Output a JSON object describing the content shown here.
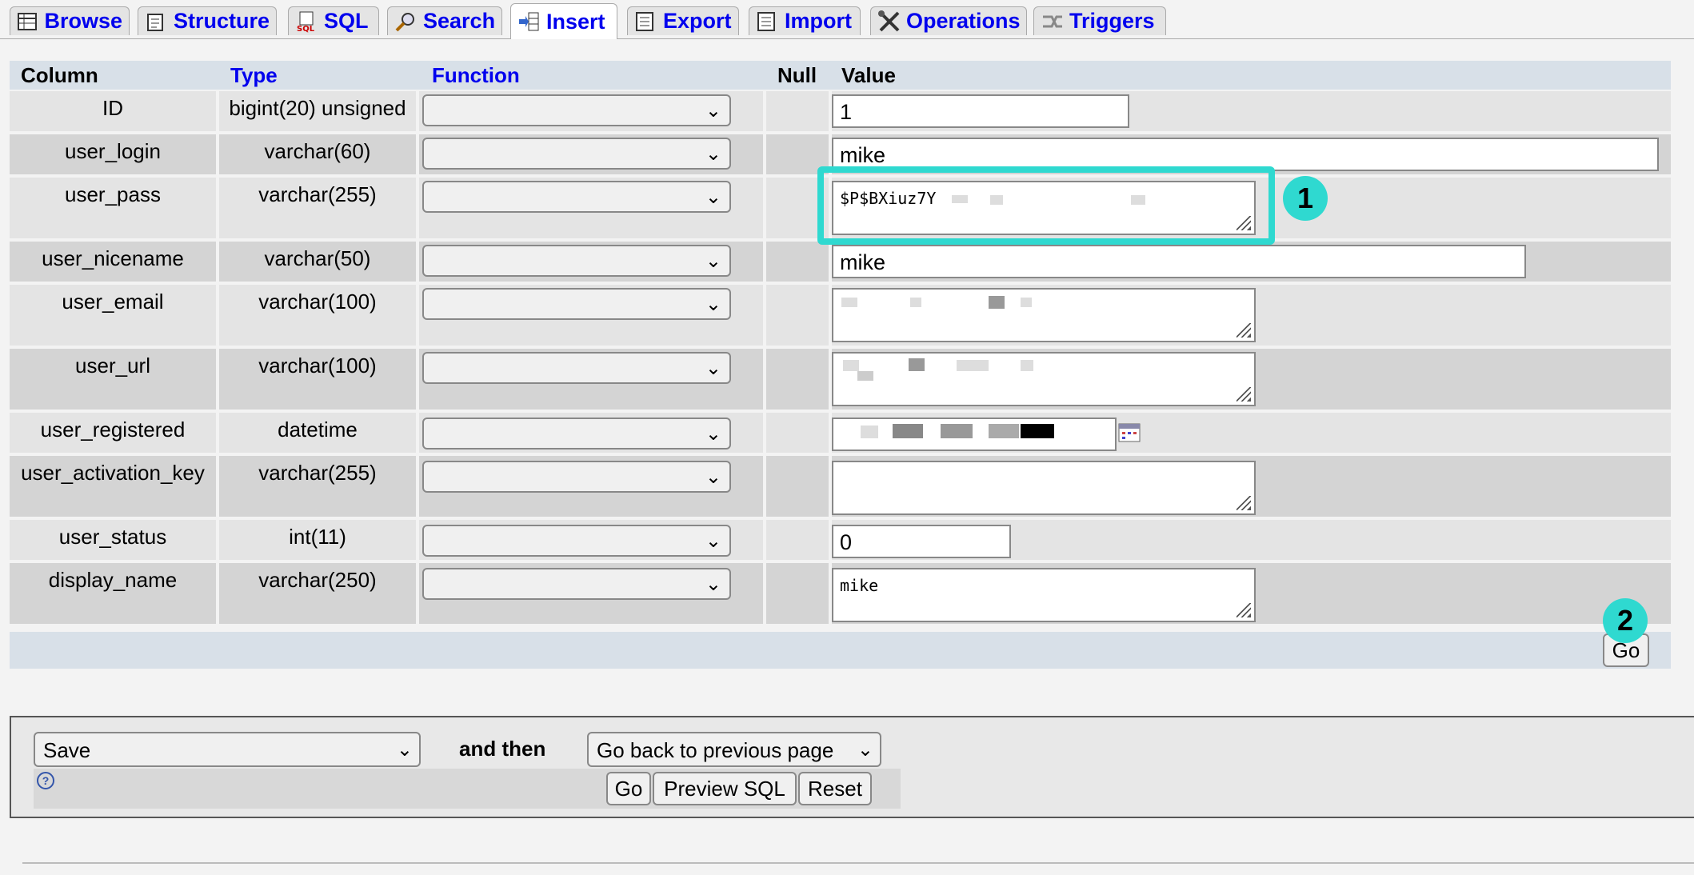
{
  "tabs": [
    {
      "label": "Browse",
      "icon": "browse-icon",
      "active": false
    },
    {
      "label": "Structure",
      "icon": "structure-icon",
      "active": false
    },
    {
      "label": "SQL",
      "icon": "sql-icon",
      "active": false
    },
    {
      "label": "Search",
      "icon": "search-icon",
      "active": false
    },
    {
      "label": "Insert",
      "icon": "insert-icon",
      "active": true
    },
    {
      "label": "Export",
      "icon": "export-icon",
      "active": false
    },
    {
      "label": "Import",
      "icon": "import-icon",
      "active": false
    },
    {
      "label": "Operations",
      "icon": "operations-icon",
      "active": false
    },
    {
      "label": "Triggers",
      "icon": "triggers-icon",
      "active": false
    }
  ],
  "table": {
    "headers": {
      "column": "Column",
      "type": "Type",
      "function": "Function",
      "null": "Null",
      "value": "Value"
    },
    "rows": [
      {
        "column": "ID",
        "type": "bigint(20) unsigned",
        "value": "1",
        "input": "text"
      },
      {
        "column": "user_login",
        "type": "varchar(60)",
        "value": "mike",
        "input": "text"
      },
      {
        "column": "user_pass",
        "type": "varchar(255)",
        "value": "$P$BXiuz7Y",
        "input": "textarea"
      },
      {
        "column": "user_nicename",
        "type": "varchar(50)",
        "value": "mike",
        "input": "text"
      },
      {
        "column": "user_email",
        "type": "varchar(100)",
        "value": "",
        "input": "textarea"
      },
      {
        "column": "user_url",
        "type": "varchar(100)",
        "value": "",
        "input": "textarea"
      },
      {
        "column": "user_registered",
        "type": "datetime",
        "value": "",
        "input": "datetime"
      },
      {
        "column": "user_activation_key",
        "type": "varchar(255)",
        "value": "",
        "input": "textarea"
      },
      {
        "column": "user_status",
        "type": "int(11)",
        "value": "0",
        "input": "text"
      },
      {
        "column": "display_name",
        "type": "varchar(250)",
        "value": "mike",
        "input": "textarea"
      }
    ],
    "go_label": "Go"
  },
  "annotations": {
    "one": "1",
    "two": "2"
  },
  "bottom_form": {
    "action_select": "Save",
    "and_then": "and then",
    "after_select": "Go back to previous page",
    "go": "Go",
    "preview": "Preview SQL",
    "reset": "Reset",
    "help_icon": "help-icon"
  },
  "colors": {
    "tab_link": "#0000ee",
    "highlight": "#2fd9d0",
    "header_bg": "#d8e0e8"
  }
}
